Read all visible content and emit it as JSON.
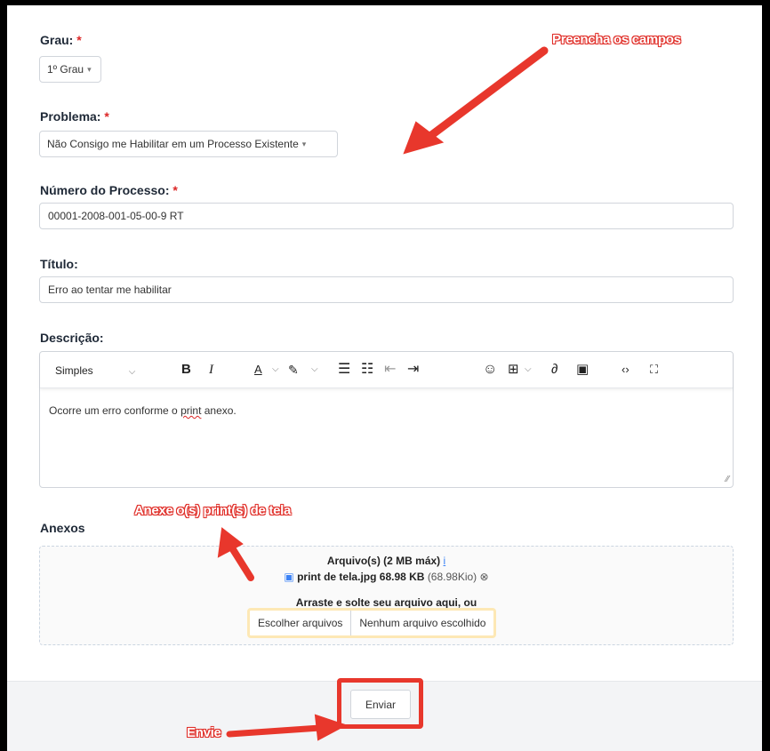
{
  "form": {
    "grau": {
      "label": "Grau:",
      "required_mark": "*",
      "value": "1º Grau"
    },
    "problema": {
      "label": "Problema:",
      "required_mark": "*",
      "value": "Não Consigo me Habilitar em um Processo Existente"
    },
    "numero": {
      "label": "Número do Processo:",
      "required_mark": "*",
      "value": "00001-2008-001-05-00-9 RT"
    },
    "titulo": {
      "label": "Título:",
      "value": "Erro ao tentar me habilitar"
    },
    "descricao": {
      "label": "Descrição:",
      "style_select": "Simples",
      "text_before": "Ocorre um erro conforme o ",
      "text_misspelled": "print",
      "text_after": " anexo."
    },
    "anexos": {
      "label": "Anexos",
      "limit_text": "Arquivo(s) (2 MB máx)",
      "info_icon": "i",
      "file_name": "print de tela.jpg 68.98 KB",
      "file_size_alt": "(68.98Kio)",
      "drop_text": "Arraste e solte seu arquivo aqui, ou",
      "choose_button": "Escolher arquivos",
      "no_file_text": "Nenhum arquivo escolhido"
    },
    "submit_label": "Enviar"
  },
  "annotations": {
    "fill_fields": "Preencha os campos",
    "attach_prints": "Anexe o(s) print(s) de tela",
    "send": "Envie",
    "color": "#e8372c"
  },
  "toolbar_icons": [
    "bold-icon",
    "italic-icon",
    "font-color-icon",
    "highlight-icon",
    "bullet-list-icon",
    "numbered-list-icon",
    "outdent-icon",
    "indent-icon",
    "emoji-icon",
    "table-icon",
    "link-icon",
    "image-icon",
    "code-view-icon",
    "fullscreen-icon"
  ]
}
